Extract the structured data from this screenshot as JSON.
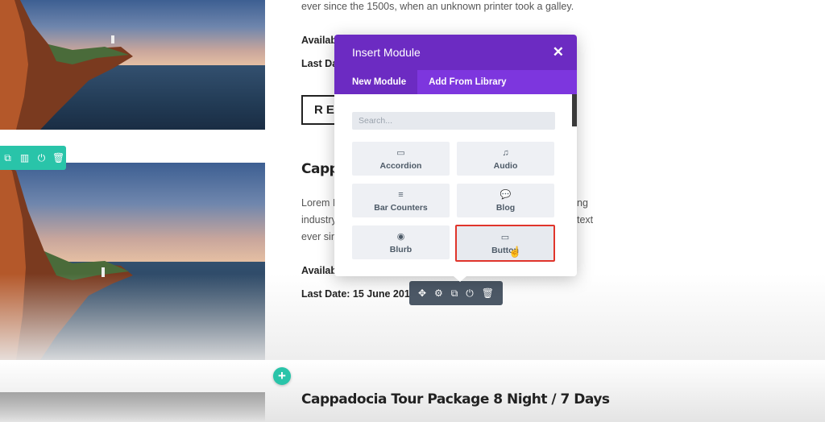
{
  "page": {
    "intro_line": "ever since the 1500s, when an unknown printer took a galley.",
    "available_label_1": "Availab",
    "last_date_label_1": "Last Da",
    "read_more_label": "REA",
    "card2": {
      "title": "Cappa",
      "para_line1_left": "Lorem I",
      "para_line1_right": "ng",
      "para_line2_left": "industry",
      "para_line2_right": "text",
      "para_line3_left": "ever sin",
      "available_label": "Availab",
      "last_date_label": "Last Date: 15 June 2017"
    },
    "card3": {
      "title": "Cappadocia Tour Package 8 Night / 7 Days"
    }
  },
  "row_toolbar": {
    "icons": [
      "duplicate-icon",
      "columns-icon",
      "power-icon",
      "trash-icon"
    ]
  },
  "module_toolbar": {
    "icons": [
      "move-icon",
      "gear-icon",
      "duplicate-icon",
      "power-icon",
      "trash-icon"
    ]
  },
  "modal": {
    "title": "Insert Module",
    "tabs": [
      "New Module",
      "Add From Library"
    ],
    "active_tab": "New Module",
    "search_placeholder": "Search...",
    "modules": [
      {
        "label": "Accordion",
        "icon": "accordion-icon"
      },
      {
        "label": "Audio",
        "icon": "music-note-icon"
      },
      {
        "label": "Bar Counters",
        "icon": "bar-counter-icon"
      },
      {
        "label": "Blog",
        "icon": "speech-bubble-icon"
      },
      {
        "label": "Blurb",
        "icon": "pin-icon"
      },
      {
        "label": "Button",
        "icon": "button-icon"
      }
    ],
    "highlighted_module": "Button"
  },
  "colors": {
    "accent_purple": "#6c2bc2",
    "tab_purple": "#7d36de",
    "teal": "#29c4a9",
    "highlight_red": "#e0352b",
    "toolbar_dark": "#4c5866"
  }
}
